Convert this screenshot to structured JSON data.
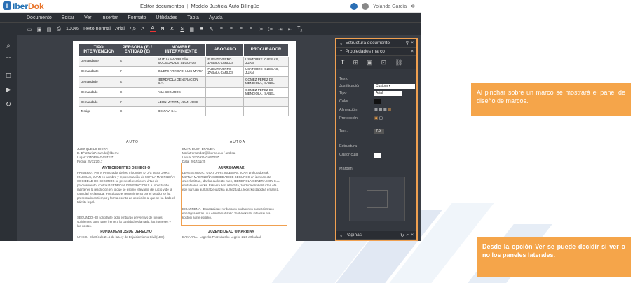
{
  "app": {
    "logo": "IberDok",
    "window_title": "Editor documentos",
    "doc_name": "Modelo Justicia Auto Bilingüe",
    "user": "Yolanda García"
  },
  "menu": [
    "Documento",
    "Editar",
    "Ver",
    "Insertar",
    "Formato",
    "Utilidades",
    "Tabla",
    "Ayuda"
  ],
  "toolbar": {
    "zoom": "100%",
    "style": "Texto normal",
    "font": "Arial",
    "size": "7,5"
  },
  "table": {
    "headers": [
      "TIPO INTERVENCION",
      "PERSONA (F) / ENTIDAD (E)",
      "NOMBRE INTERVINIENTE",
      "ABOGADO",
      "PROCURADOR"
    ],
    "rows": [
      [
        "Demandante",
        "E",
        "MUTUA MADRILEÑA SOCIEDAD DE SEGUROS",
        "FUENTEVERRO ZABALA CARLOS",
        "USATORRE IGLESIAS, JUAN"
      ],
      [
        "Demandante",
        "F",
        "GILETE ARROYO, LUIS MARIA",
        "FUENTEVERRO ZABALA CARLOS",
        "USATORRE IGLESIAS, JUAN"
      ],
      [
        "Demandado",
        "E",
        "IBERDROLA GENERACION S.A.",
        "",
        "GOMEZ PEREZ DE MENDIOLA, ISABEL"
      ],
      [
        "Demandado",
        "E",
        "AXA SEGUROS",
        "",
        "GOMEZ PEREZ DE MENDIOLA, ISABEL"
      ],
      [
        "Demandado",
        "F",
        "LEON MARTIN, JUAN JOSE",
        "",
        ""
      ],
      [
        "Testigo",
        "E",
        "DELTAVI S.L.",
        "",
        ""
      ]
    ]
  },
  "doc": {
    "auto": "AUTO",
    "autoa": "AUTOA",
    "left_meta": "JUEZ QUE LO DICTA:\nD. D^aMariaPerarnde@liberne\nLugar: VITORIA-GASTEIZ\nFecha: 25/11/2017",
    "right_meta": "EMAN DUEN EPAILEA:\nMariaFernandez@liberne.eus / andrea\nLekua: VITORIA-GASTEIZ\nData: 2017/11/25",
    "hechos": "ANTECEDENTES DE HECHO",
    "aurrekariak": "AURREKARIAK",
    "left_p1": "PRIMERO.- Por el Procurador de los Tribunales D D^a USATORRE IGLESIAS, JUAN en nombre y representación de MUTUA MADRILEÑA SOCIEDAD DE SEGUROS se presentó escrito en virtud de procedimiento, contra IBERDROLA GENERACION S.A. solicitando mantener la resolución en lo que se estimó relevante del juicio y de la cantidad reclamada. Practicado el requerimiento por el deudor se ha presentado en tiempo y forma escrito de oposición al que se ha dado el trámite legal.",
    "left_p2": "SEGUNDO.- El solicitante pidió embargo preventivo de bienes suficientes para hacer frente a la cantidad reclamada, los intereses y las costas.",
    "right_p1": "LEHENENGOA.- USATORRE IGLESIAS, JUAN prokuradoreak, MUTUA MADRILEÑA SOCIEDAD DE SEGUROS en izenean eta ordezkaritzan, idazkia aurkeztu zuen, IBERDROLA GENERACION S.A. entitatearen aurka. Eskaera hori aztertuta, zorduna errekeritu zen eta epe barruan aurkaratze idazkia aurkeztu du, legezko izapidea emanez.",
    "right_p2": "BIGARRENA.- Eskatzaileak zordunaren ondasunen aurrezaintzako enbargoa eskatu du, erreklamatutako zenbatekoari, interesei eta kostuei aurre egiteko.",
    "fundamentos": "FUNDAMENTOS DE DERECHO",
    "zuzenbide": "ZUZENBIDEKO OINARRIAK",
    "left_p3": "UNICO.- El artículo 21.5 de la Ley de Enjuiciamiento Civil (LEC)",
    "right_p3": "BAKARRA.- Legezko Prozedurako Legeko 21.5 artikuluak"
  },
  "panel": {
    "title": "Estructura documento",
    "sub": "Propiedades marco",
    "labels": [
      "Texto",
      "Justificación",
      "Tipo",
      "Color",
      "Alineación",
      "Protección",
      "Tam."
    ],
    "font_select": "Arial",
    "size": "7,5",
    "section": "Estructura",
    "section_sub": "Cuadrícula",
    "margen": "Margen",
    "footer": "Páginas"
  },
  "callouts": {
    "one": "Al pinchar sobre un marco se mostrará el panel de diseño de marcos.",
    "two_a": "Desde la opción Ver se puede decidir si ver o ",
    "two_no": "no",
    "two_b": " los paneles laterales."
  },
  "colors": {
    "accent": "#f5a54a",
    "app_bg": "#3b3f46"
  }
}
